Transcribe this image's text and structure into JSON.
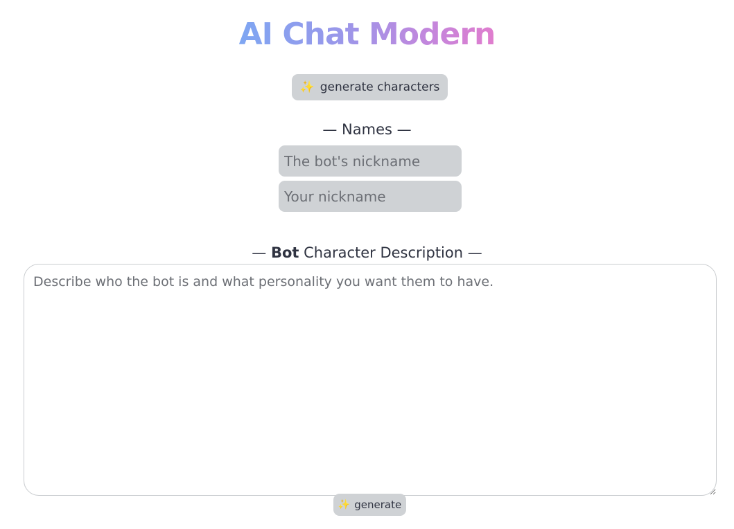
{
  "app": {
    "title": "AI Chat Modern"
  },
  "generate_characters_button": {
    "icon": "sparkles-icon",
    "label": "generate characters"
  },
  "names_section": {
    "label": "— Names —",
    "bot_nickname_placeholder": "The bot's nickname",
    "bot_nickname_value": "",
    "user_nickname_placeholder": "Your nickname",
    "user_nickname_value": ""
  },
  "description_section": {
    "label_prefix": "— ",
    "label_bold": "Bot",
    "label_suffix": " Character Description —",
    "placeholder": "Describe who the bot is and what personality you want them to have.",
    "value": ""
  },
  "generate_button": {
    "icon": "sparkles-icon",
    "label": "generate"
  },
  "colors": {
    "title_gradient_start": "#7ea6f2",
    "title_gradient_end": "#e07dce",
    "button_bg": "#cfd2d5",
    "text": "#2f3341",
    "sparkle": "#f2b52b"
  }
}
